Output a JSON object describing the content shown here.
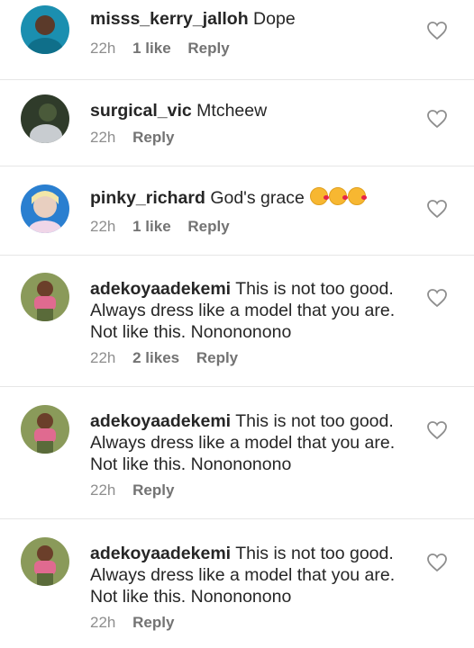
{
  "comments": [
    {
      "username": "misss_kerry_jalloh",
      "text": "Dope",
      "time": "22h",
      "likes": "1 like",
      "reply": "Reply"
    },
    {
      "username": "surgical_vic",
      "text": "Mtcheew",
      "time": "22h",
      "likes": "",
      "reply": "Reply"
    },
    {
      "username": "pinky_richard",
      "text": "God's grace",
      "time": "22h",
      "likes": "1 like",
      "reply": "Reply",
      "emoji": [
        "kissing-heart-emoji",
        "kissing-heart-emoji",
        "kissing-heart-emoji"
      ]
    },
    {
      "username": "adekoyaadekemi",
      "text": "This is not too good. Always dress like a model that you are. Not like this. Nonononono",
      "time": "22h",
      "likes": "2 likes",
      "reply": "Reply"
    },
    {
      "username": "adekoyaadekemi",
      "text": "This is not too good. Always dress like a model that you are. Not like this. Nonononono",
      "time": "22h",
      "likes": "",
      "reply": "Reply"
    },
    {
      "username": "adekoyaadekemi",
      "text": "This is not too good. Always dress like a model that you are. Not like this. Nonononono",
      "time": "22h",
      "likes": "",
      "reply": "Reply"
    }
  ],
  "icons": {
    "like": "heart-outline-icon"
  }
}
